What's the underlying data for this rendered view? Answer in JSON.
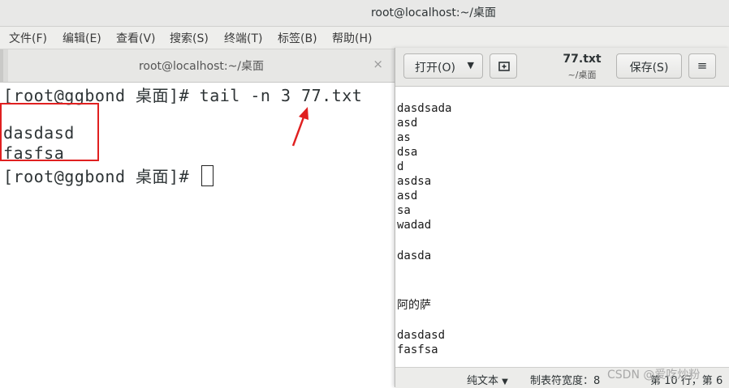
{
  "window": {
    "title": "root@localhost:~/桌面"
  },
  "menubar": {
    "items": [
      "文件(F)",
      "编辑(E)",
      "查看(V)",
      "搜索(S)",
      "终端(T)",
      "标签(B)",
      "帮助(H)"
    ]
  },
  "terminal_tab": {
    "label": "root@localhost:~/桌面",
    "close": "×"
  },
  "terminal": {
    "lines": [
      "[root@ggbond 桌面]# tail -n 3 77.txt",
      "",
      "dasdasd",
      "fasfsa",
      "[root@ggbond 桌面]# "
    ]
  },
  "gedit": {
    "open_label": "打开(O)",
    "file_name": "77.txt",
    "file_path": "~/桌面",
    "save_label": "保存(S)",
    "menu_label": "≡",
    "lines": [
      "",
      "dasdsada",
      "asd",
      "as",
      "dsa",
      "d",
      "asdsa",
      "asd",
      "sa",
      "wadad",
      "",
      "dasda",
      "",
      "",
      "阿的萨",
      "",
      "dasdasd",
      "fasfsa"
    ],
    "status": {
      "syntax": "纯文本",
      "tab_width": "制表符宽度：8",
      "position": "第 10 行，第 6"
    }
  },
  "annotation": {
    "highlight_color": "#e02020",
    "arrow_color": "#e02020"
  },
  "watermark": "CSDN @爱吃炒粉"
}
